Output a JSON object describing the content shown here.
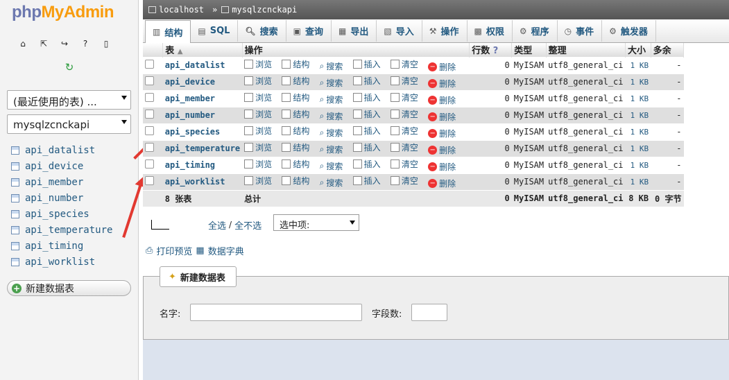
{
  "logo": {
    "php": "php",
    "my": "My",
    "admin": "Admin"
  },
  "sidebar": {
    "recent_label": "(最近使用的表) ...",
    "db_label": "mysqlzcnckapi",
    "tables": [
      "api_datalist",
      "api_device",
      "api_member",
      "api_number",
      "api_species",
      "api_temperature",
      "api_timing",
      "api_worklist"
    ],
    "new_table_label": "新建数据表"
  },
  "breadcrumb": {
    "server": "localhost",
    "database": "mysqlzcnckapi",
    "separator": "»"
  },
  "tabs": [
    {
      "label": "结构",
      "icon": "structure-icon"
    },
    {
      "label": "SQL",
      "icon": "sql-icon"
    },
    {
      "label": "搜索",
      "icon": "search-icon"
    },
    {
      "label": "查询",
      "icon": "query-icon"
    },
    {
      "label": "导出",
      "icon": "export-icon"
    },
    {
      "label": "导入",
      "icon": "import-icon"
    },
    {
      "label": "操作",
      "icon": "wrench-icon"
    },
    {
      "label": "权限",
      "icon": "privileges-icon"
    },
    {
      "label": "程序",
      "icon": "routines-icon"
    },
    {
      "label": "事件",
      "icon": "events-icon"
    },
    {
      "label": "触发器",
      "icon": "triggers-icon"
    }
  ],
  "grid": {
    "headers": {
      "table": "表",
      "actions": "操作",
      "rows": "行数",
      "type": "类型",
      "collation": "整理",
      "size": "大小",
      "overhead": "多余"
    },
    "actions": {
      "browse": "浏览",
      "structure": "结构",
      "search": "搜索",
      "insert": "插入",
      "empty": "清空",
      "drop": "删除"
    },
    "rows": [
      {
        "name": "api_datalist",
        "count": "0",
        "engine": "MyISAM",
        "collation": "utf8_general_ci",
        "size": "1 KB",
        "overhead": "-"
      },
      {
        "name": "api_device",
        "count": "0",
        "engine": "MyISAM",
        "collation": "utf8_general_ci",
        "size": "1 KB",
        "overhead": "-"
      },
      {
        "name": "api_member",
        "count": "0",
        "engine": "MyISAM",
        "collation": "utf8_general_ci",
        "size": "1 KB",
        "overhead": "-"
      },
      {
        "name": "api_number",
        "count": "0",
        "engine": "MyISAM",
        "collation": "utf8_general_ci",
        "size": "1 KB",
        "overhead": "-"
      },
      {
        "name": "api_species",
        "count": "0",
        "engine": "MyISAM",
        "collation": "utf8_general_ci",
        "size": "1 KB",
        "overhead": "-"
      },
      {
        "name": "api_temperature",
        "count": "0",
        "engine": "MyISAM",
        "collation": "utf8_general_ci",
        "size": "1 KB",
        "overhead": "-"
      },
      {
        "name": "api_timing",
        "count": "0",
        "engine": "MyISAM",
        "collation": "utf8_general_ci",
        "size": "1 KB",
        "overhead": "-"
      },
      {
        "name": "api_worklist",
        "count": "0",
        "engine": "MyISAM",
        "collation": "utf8_general_ci",
        "size": "1 KB",
        "overhead": "-"
      }
    ],
    "total": {
      "name": "8 张表",
      "label": "总计",
      "count": "0",
      "engine": "MyISAM",
      "collation": "utf8_general_ci",
      "size": "8 KB",
      "overhead": "0 字节"
    }
  },
  "bottom": {
    "select_all": "全选",
    "select_sep": "/",
    "deselect_all": "全不选",
    "with_selected": "选中项:"
  },
  "print": {
    "print_label": "打印预览",
    "dictionary_label": "数据字典"
  },
  "create": {
    "legend": "新建数据表",
    "name_label": "名字:",
    "columns_label": "字段数:"
  }
}
